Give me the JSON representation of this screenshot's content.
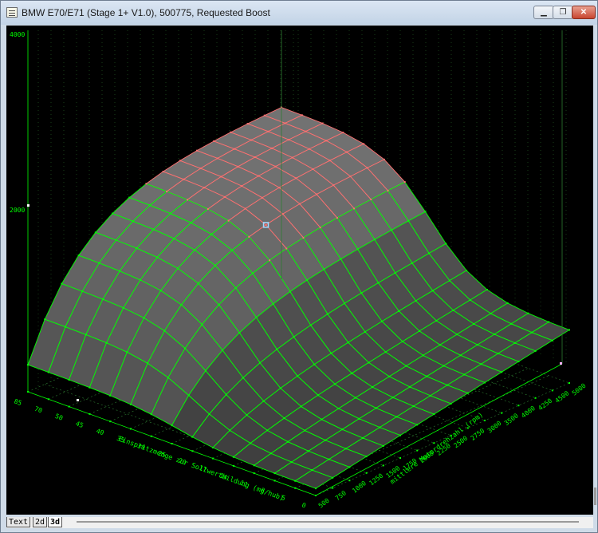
{
  "window": {
    "title": "BMW E70/E71 (Stage 1+ V1.0), 500775, Requested Boost",
    "minimize_glyph": "▁",
    "restore_glyph": "❐",
    "close_glyph": "✕"
  },
  "plot": {
    "z_ticks": [
      "4000",
      "2000"
    ],
    "x_axis": {
      "label": "Einspritzmenge zur Sollwertbildung (mg/hub)",
      "ticks": [
        "85",
        "70",
        "50",
        "45",
        "40",
        "35",
        "30",
        "25",
        "20",
        "17",
        "14",
        "11",
        "8",
        "5",
        "0"
      ]
    },
    "y_axis": {
      "label": "mittlere Motordrehzahl (rpm)",
      "ticks": [
        "500",
        "750",
        "1000",
        "1250",
        "1500",
        "1750",
        "2000",
        "2250",
        "2500",
        "2750",
        "3000",
        "3500",
        "4000",
        "4250",
        "4500",
        "5000"
      ]
    },
    "colors": {
      "background": "#000000",
      "grid": "#2e7d32",
      "mesh": "#00ff00",
      "selected_mesh": "#ff7070",
      "surface": "#5a5a5a"
    }
  },
  "tabs": [
    {
      "label": "Text"
    },
    {
      "label": "2d"
    },
    {
      "label": "3d"
    }
  ]
}
